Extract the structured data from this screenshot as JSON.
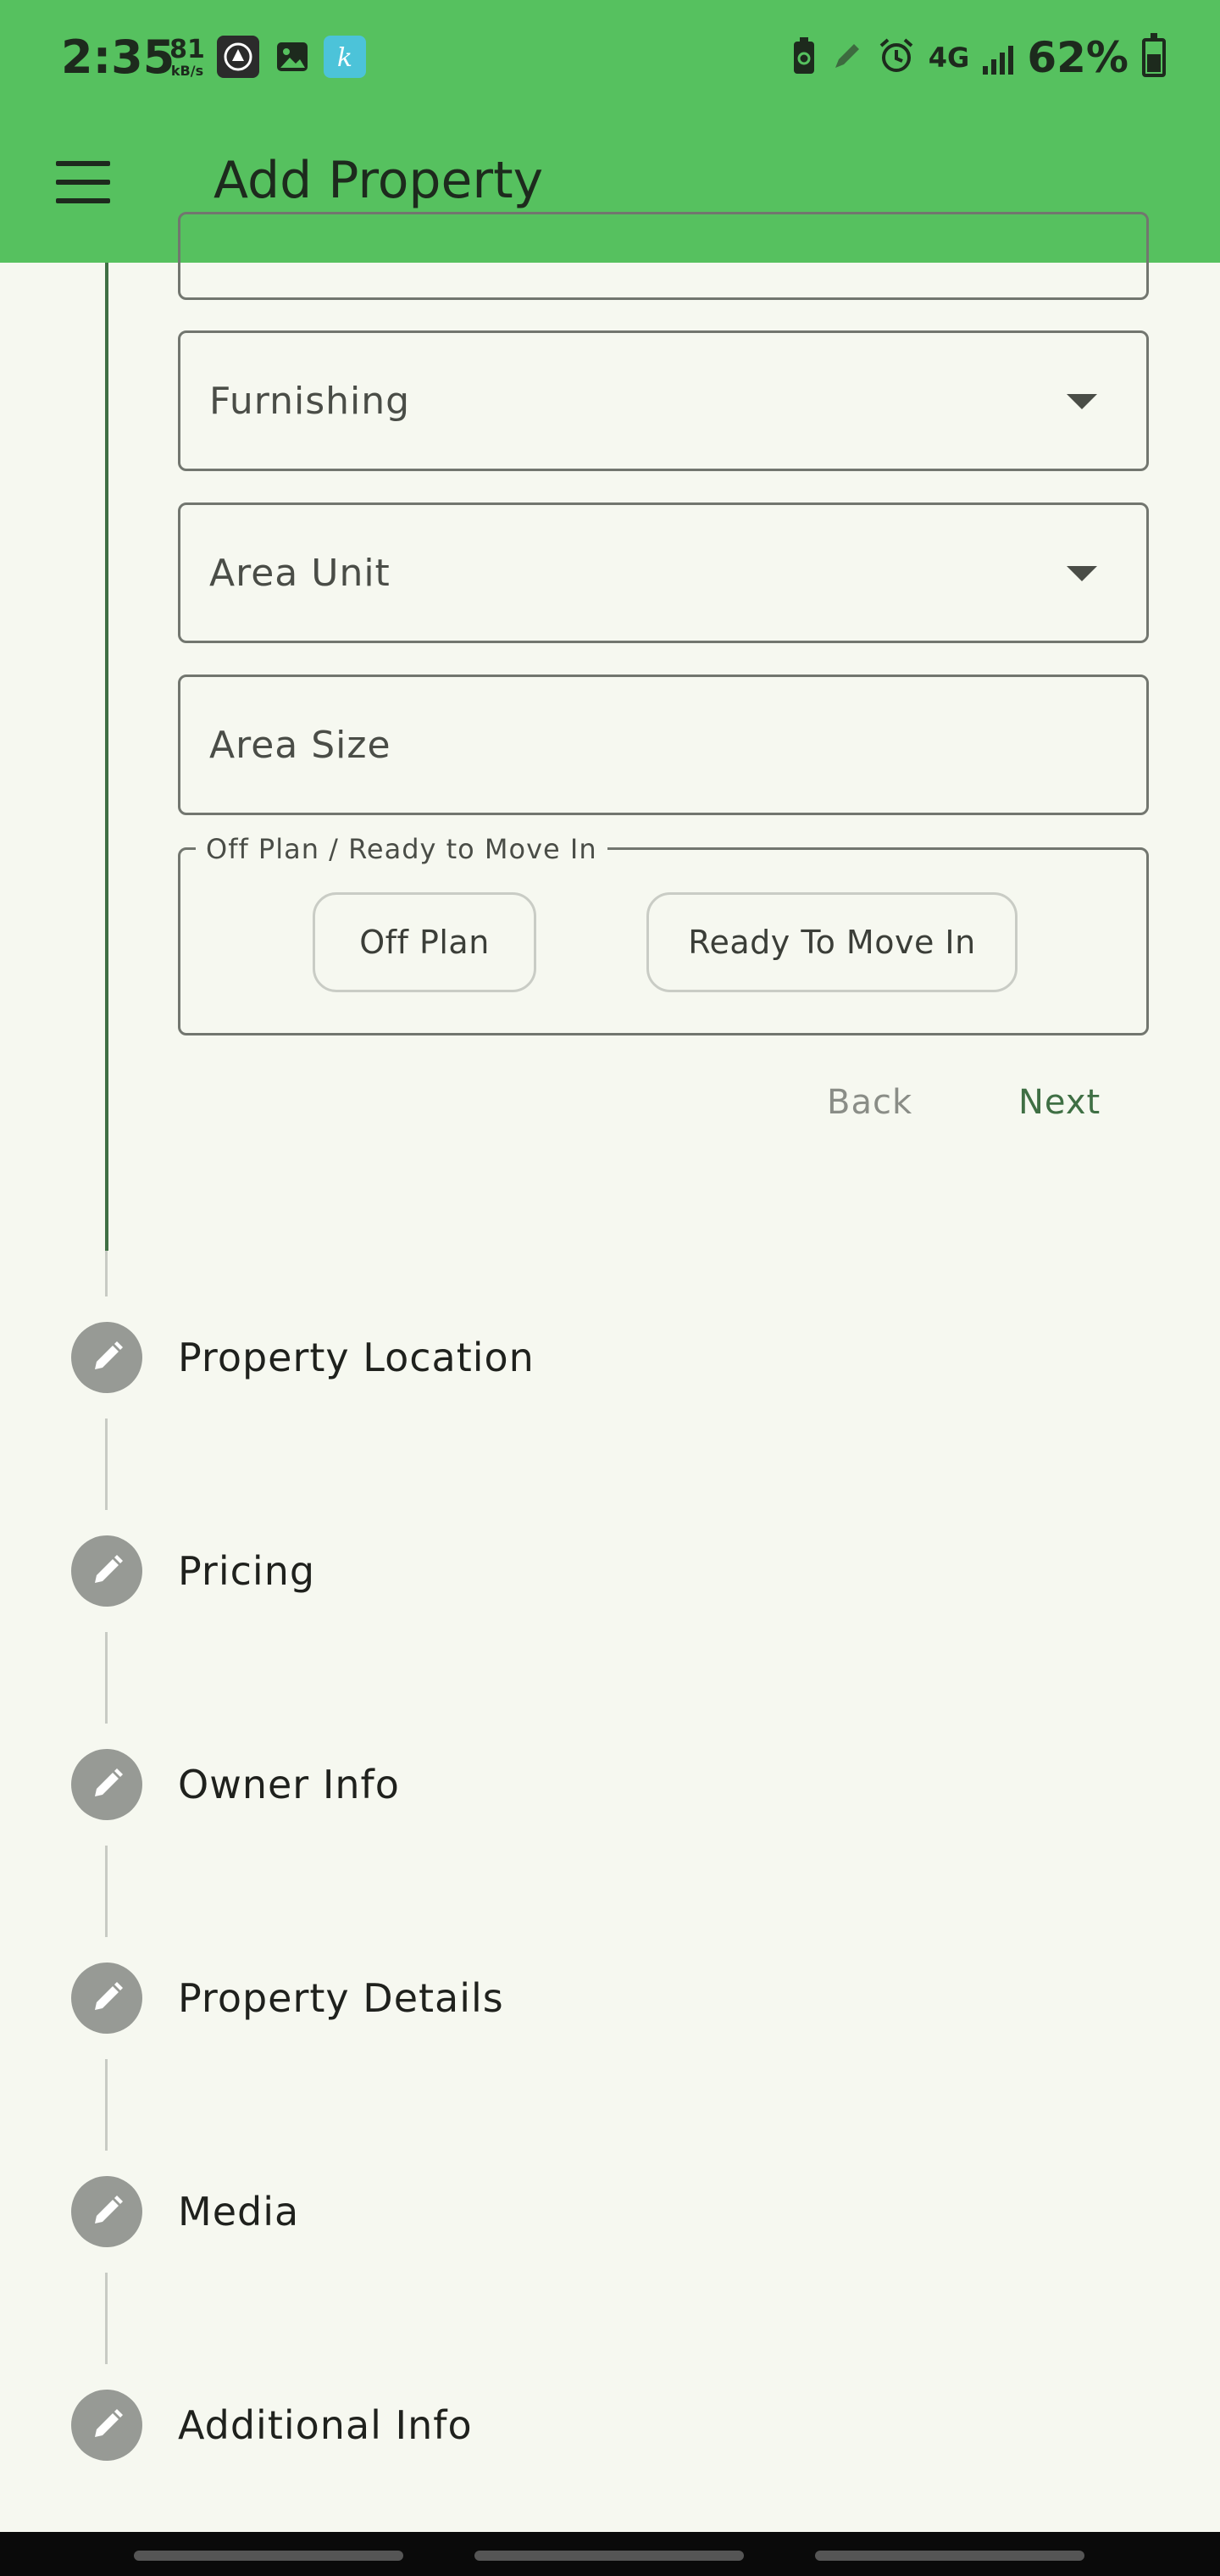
{
  "status": {
    "time": "2:35",
    "speed_value": "81",
    "speed_unit": "kB/s",
    "network": "4G",
    "battery": "62%"
  },
  "appbar": {
    "title": "Add Property",
    "menu_icon": "hamburger-menu-icon"
  },
  "form": {
    "furnishing_placeholder": "Furnishing",
    "area_unit_placeholder": "Area Unit",
    "area_size_placeholder": "Area Size",
    "possession_legend": "Off Plan / Ready to Move In",
    "options": [
      "Off Plan",
      "Ready To Move In"
    ],
    "back_label": "Back",
    "next_label": "Next"
  },
  "steps": [
    {
      "label": "Property Location",
      "icon": "pencil-icon"
    },
    {
      "label": "Pricing",
      "icon": "pencil-icon"
    },
    {
      "label": "Owner Info",
      "icon": "pencil-icon"
    },
    {
      "label": "Property Details",
      "icon": "pencil-icon"
    },
    {
      "label": "Media",
      "icon": "pencil-icon"
    },
    {
      "label": "Additional Info",
      "icon": "pencil-icon"
    }
  ],
  "colors": {
    "appbar": "#56c15f",
    "background": "#f6f8f0",
    "active_step_line": "#3f6f44",
    "next_button": "#3f6f44",
    "back_button": "#8a8d87",
    "step_icon_bg": "#979a95"
  }
}
